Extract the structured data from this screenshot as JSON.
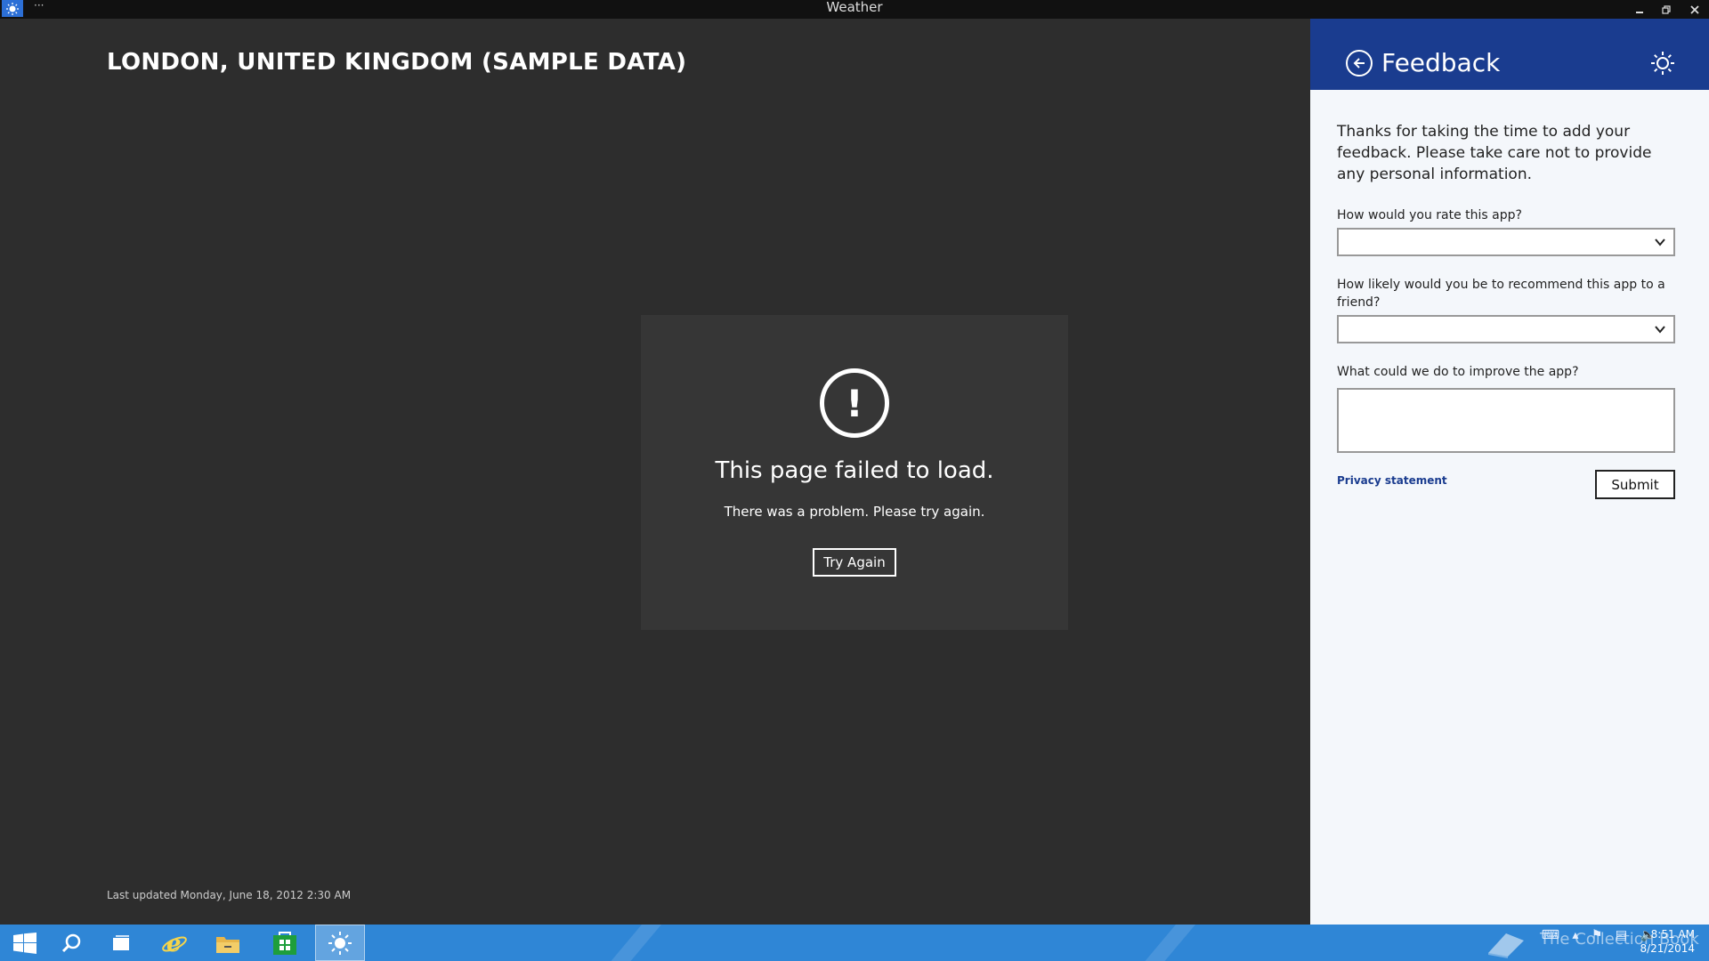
{
  "window": {
    "title": "Weather",
    "menu_dots": "···",
    "minimize": "–",
    "restore": "❐",
    "close": "✕"
  },
  "main": {
    "location": "LONDON, UNITED KINGDOM (SAMPLE DATA)",
    "error": {
      "symbol": "!",
      "heading": "This page failed to load.",
      "message": "There was a problem. Please try again.",
      "button": "Try Again"
    },
    "last_updated": "Last updated Monday, June 18, 2012 2:30 AM"
  },
  "feedback": {
    "title": "Feedback",
    "intro": "Thanks for taking the time to add your feedback. Please take care not to provide any personal information.",
    "q_rate": "How would you rate this app?",
    "q_recommend": "How likely would you be to recommend this app to a friend?",
    "q_improve": "What could we do to improve the app?",
    "privacy": "Privacy statement",
    "submit": "Submit",
    "header_color": "#1a3c8f"
  },
  "taskbar": {
    "color": "#2f86d6",
    "watermark": "The Collection Book",
    "time": "8:51 AM",
    "date": "8/21/2014"
  }
}
